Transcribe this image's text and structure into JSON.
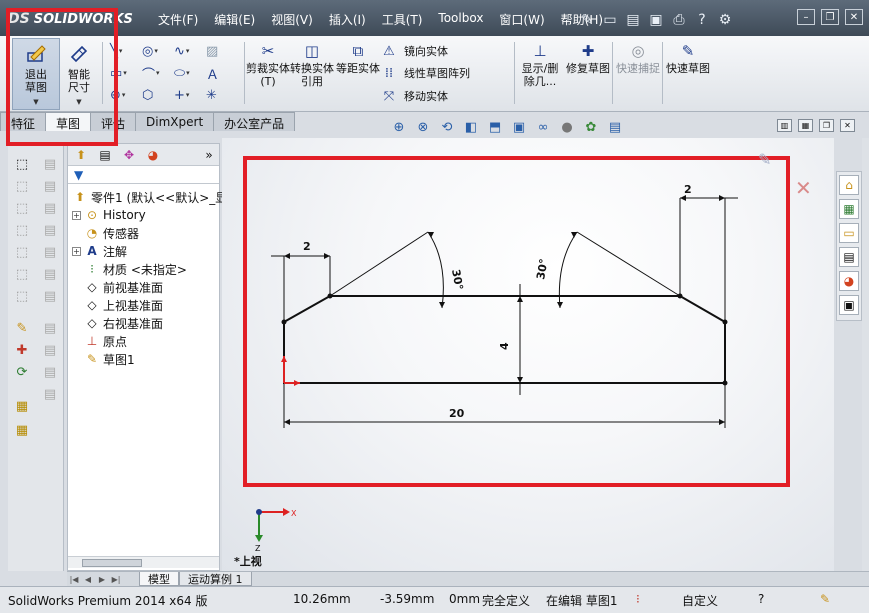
{
  "app": {
    "logo_prefix": "DS",
    "logo": "SOLIDWORKS"
  },
  "menu": [
    "文件(F)",
    "编辑(E)",
    "视图(V)",
    "插入(I)",
    "工具(T)",
    "Toolbox",
    "窗口(W)",
    "帮助(H)"
  ],
  "quick_icons": [
    "pin-icon",
    "new-icon",
    "open-icon",
    "save-icon",
    "print-icon",
    "help-icon",
    "options-icon"
  ],
  "window_controls": [
    "minimize",
    "restore",
    "close"
  ],
  "ribbon": {
    "exit_sketch": "退出草图",
    "smart_dim": "智能尺寸",
    "trim": "剪裁实体(T)",
    "convert": "转换实体引用",
    "offset": "等距实体",
    "mirror": "镜向实体",
    "linear_pattern": "线性草图阵列",
    "move": "移动实体",
    "display_delete": "显示/删除几...",
    "repair": "修复草图",
    "quick_snap": "快速捕捉",
    "rapid_sketch": "快速草图"
  },
  "tabs": [
    "特征",
    "草图",
    "评估",
    "DimXpert",
    "办公室产品"
  ],
  "active_tab": "草图",
  "feature_tree": {
    "root": "零件1 (默认<<默认>_显",
    "items": [
      {
        "label": "History",
        "icon": "history-icon",
        "expandable": true
      },
      {
        "label": "传感器",
        "icon": "sensor-icon",
        "expandable": false
      },
      {
        "label": "注解",
        "icon": "annotation-icon",
        "expandable": true
      },
      {
        "label": "材质 <未指定>",
        "icon": "material-icon",
        "expandable": false
      },
      {
        "label": "前视基准面",
        "icon": "plane-icon",
        "expandable": false
      },
      {
        "label": "上视基准面",
        "icon": "plane-icon",
        "expandable": false
      },
      {
        "label": "右视基准面",
        "icon": "plane-icon",
        "expandable": false
      },
      {
        "label": "原点",
        "icon": "origin-icon",
        "expandable": false
      },
      {
        "label": "草图1",
        "icon": "sketch-icon",
        "expandable": false
      }
    ]
  },
  "sketch": {
    "dim_left_top": "2",
    "dim_right_top": "2",
    "angle_left": "30°",
    "angle_right": "30°",
    "dim_height": "4",
    "dim_width": "20"
  },
  "view_label": "*上视",
  "triad": {
    "x": "X",
    "z": "Z"
  },
  "bottom_tabs": [
    "模型",
    "运动算例 1"
  ],
  "status": {
    "product": "SolidWorks Premium 2014 x64 版",
    "x": "10.26mm",
    "y": "-3.59mm",
    "z": "0mm",
    "defined": "完全定义",
    "editing": "在编辑 草图1",
    "units": "自定义"
  },
  "colors": {
    "highlight": "#e21e26",
    "sketch": "#111111",
    "accent": "#1f3c8a"
  }
}
